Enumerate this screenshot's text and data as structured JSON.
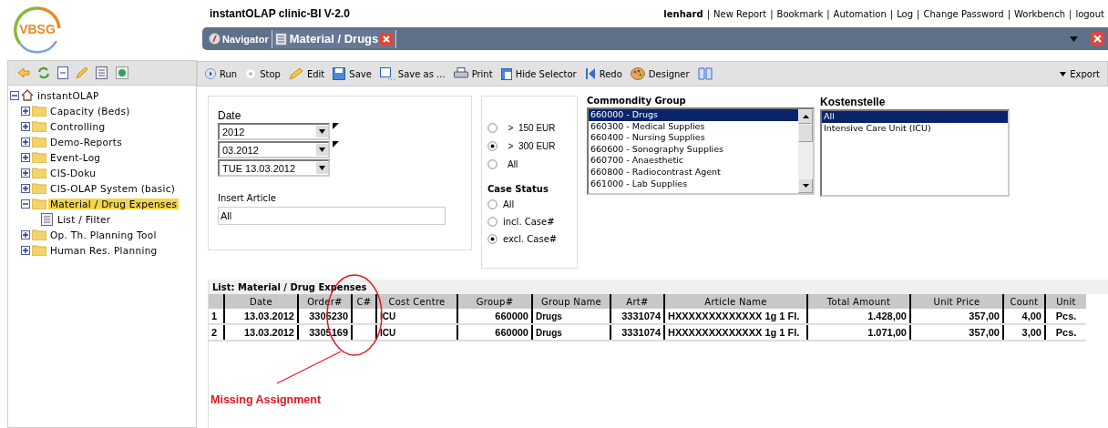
{
  "logo": {
    "text": "VBSG"
  },
  "app_title": "instantOLAP clinic-BI V-2.0",
  "user_links": {
    "separator": "|",
    "items": [
      {
        "label": "lenhard",
        "kind": "user"
      },
      {
        "label": "New Report",
        "kind": "link"
      },
      {
        "label": "Bookmark",
        "kind": "link"
      },
      {
        "label": "Automation",
        "kind": "link"
      },
      {
        "label": "Log",
        "kind": "link"
      },
      {
        "label": "Change Password",
        "kind": "link"
      },
      {
        "label": "Workbench",
        "kind": "link"
      },
      {
        "label": "logout",
        "kind": "link"
      }
    ]
  },
  "tabs": [
    {
      "label": "Navigator",
      "selected": false,
      "closable": false
    },
    {
      "label": "Material / Drugs",
      "selected": true,
      "closable": true
    }
  ],
  "toolbar": {
    "buttons": [
      {
        "label": "Run",
        "kind": "run"
      },
      {
        "label": "Stop",
        "kind": "stop"
      },
      {
        "label": "Edit",
        "kind": "edit"
      },
      {
        "label": "Save",
        "kind": "save"
      },
      {
        "label": "Save as ...",
        "kind": "saveas"
      },
      {
        "label": "Print",
        "kind": "print"
      },
      {
        "label": "Hide Selector",
        "kind": "hide"
      },
      {
        "label": "Redo",
        "kind": "redo"
      },
      {
        "label": "Designer",
        "kind": "designer"
      }
    ],
    "export": "Export"
  },
  "tree": {
    "label": "instantOLAP",
    "expanded": true,
    "children": [
      {
        "label": "Capacity (Beds)",
        "expanded": false,
        "selected": false
      },
      {
        "label": "Controlling",
        "expanded": false,
        "selected": false
      },
      {
        "label": "Demo-Reports",
        "expanded": false,
        "selected": false
      },
      {
        "label": "Event-Log",
        "expanded": false,
        "selected": false
      },
      {
        "label": "CIS-Doku",
        "expanded": false,
        "selected": false
      },
      {
        "label": "CIS-OLAP System (basic)",
        "expanded": false,
        "selected": false
      },
      {
        "label": "Material / Drug Expenses",
        "expanded": true,
        "selected": true,
        "children": [
          {
            "label": "List / Filter",
            "kind": "report"
          }
        ]
      },
      {
        "label": "Op. Th. Planning Tool",
        "expanded": false,
        "selected": false
      },
      {
        "label": "Human Res. Planning",
        "expanded": false,
        "selected": false
      }
    ]
  },
  "filters": {
    "date": {
      "label": "Date",
      "selects": [
        {
          "value": "2012",
          "flagged": true
        },
        {
          "value": "03.2012",
          "flagged": true
        },
        {
          "value": "TUE 13.03.2012",
          "flagged": false
        }
      ]
    },
    "article": {
      "label": "Insert Article",
      "value": "All"
    },
    "amount": [
      {
        "label": ">  150 EUR",
        "selected": false
      },
      {
        "label": ">  300 EUR",
        "selected": true
      },
      {
        "label": "All",
        "selected": false
      }
    ],
    "case_status": {
      "label": "Case Status",
      "options": [
        {
          "label": "All",
          "selected": false
        },
        {
          "label": "incl. Case#",
          "selected": false
        },
        {
          "label": "excl. Case#",
          "selected": true
        }
      ]
    },
    "commodity_group": {
      "label": "Commondity Group",
      "options": [
        {
          "label": "660000 - Drugs",
          "selected": true
        },
        {
          "label": "660300 - Medical Supplies",
          "selected": false
        },
        {
          "label": "660400 - Nursing Supplies",
          "selected": false
        },
        {
          "label": "660600 - Sonography Supplies",
          "selected": false
        },
        {
          "label": "660700 - Anaesthetic",
          "selected": false
        },
        {
          "label": "660800 - Radiocontrast Agent",
          "selected": false
        },
        {
          "label": "661000 - Lab Supplies",
          "selected": false
        }
      ]
    },
    "cost_center": {
      "label": "Kostenstelle",
      "options": [
        {
          "label": "All",
          "selected": true
        },
        {
          "label": "Intensive Care Unit (ICU)",
          "selected": false
        }
      ]
    }
  },
  "table": {
    "title": "List: Material / Drug Expenses",
    "columns": [
      "Date",
      "Order#",
      "C#",
      "Cost Centre",
      "Group#",
      "Group Name",
      "Art#",
      "Article Name",
      "Total Amount",
      "Unit Price",
      "Count",
      "Unit"
    ],
    "rows": [
      {
        "index": "1",
        "cells": [
          "13.03.2012",
          "3305230",
          "",
          "ICU",
          "660000",
          "Drugs",
          "3331074",
          "HXXXXXXXXXXXXX 1g 1 Fl.",
          "1.428,00",
          "357,00",
          "4,00",
          "Pcs."
        ]
      },
      {
        "index": "2",
        "cells": [
          "13.03.2012",
          "3305169",
          "",
          "ICU",
          "660000",
          "Drugs",
          "3331074",
          "HXXXXXXXXXXXXX 1g 1 Fl.",
          "1.071,00",
          "357,00",
          "3,00",
          "Pcs."
        ]
      }
    ]
  },
  "annotation": {
    "text": "Missing Assignment"
  }
}
